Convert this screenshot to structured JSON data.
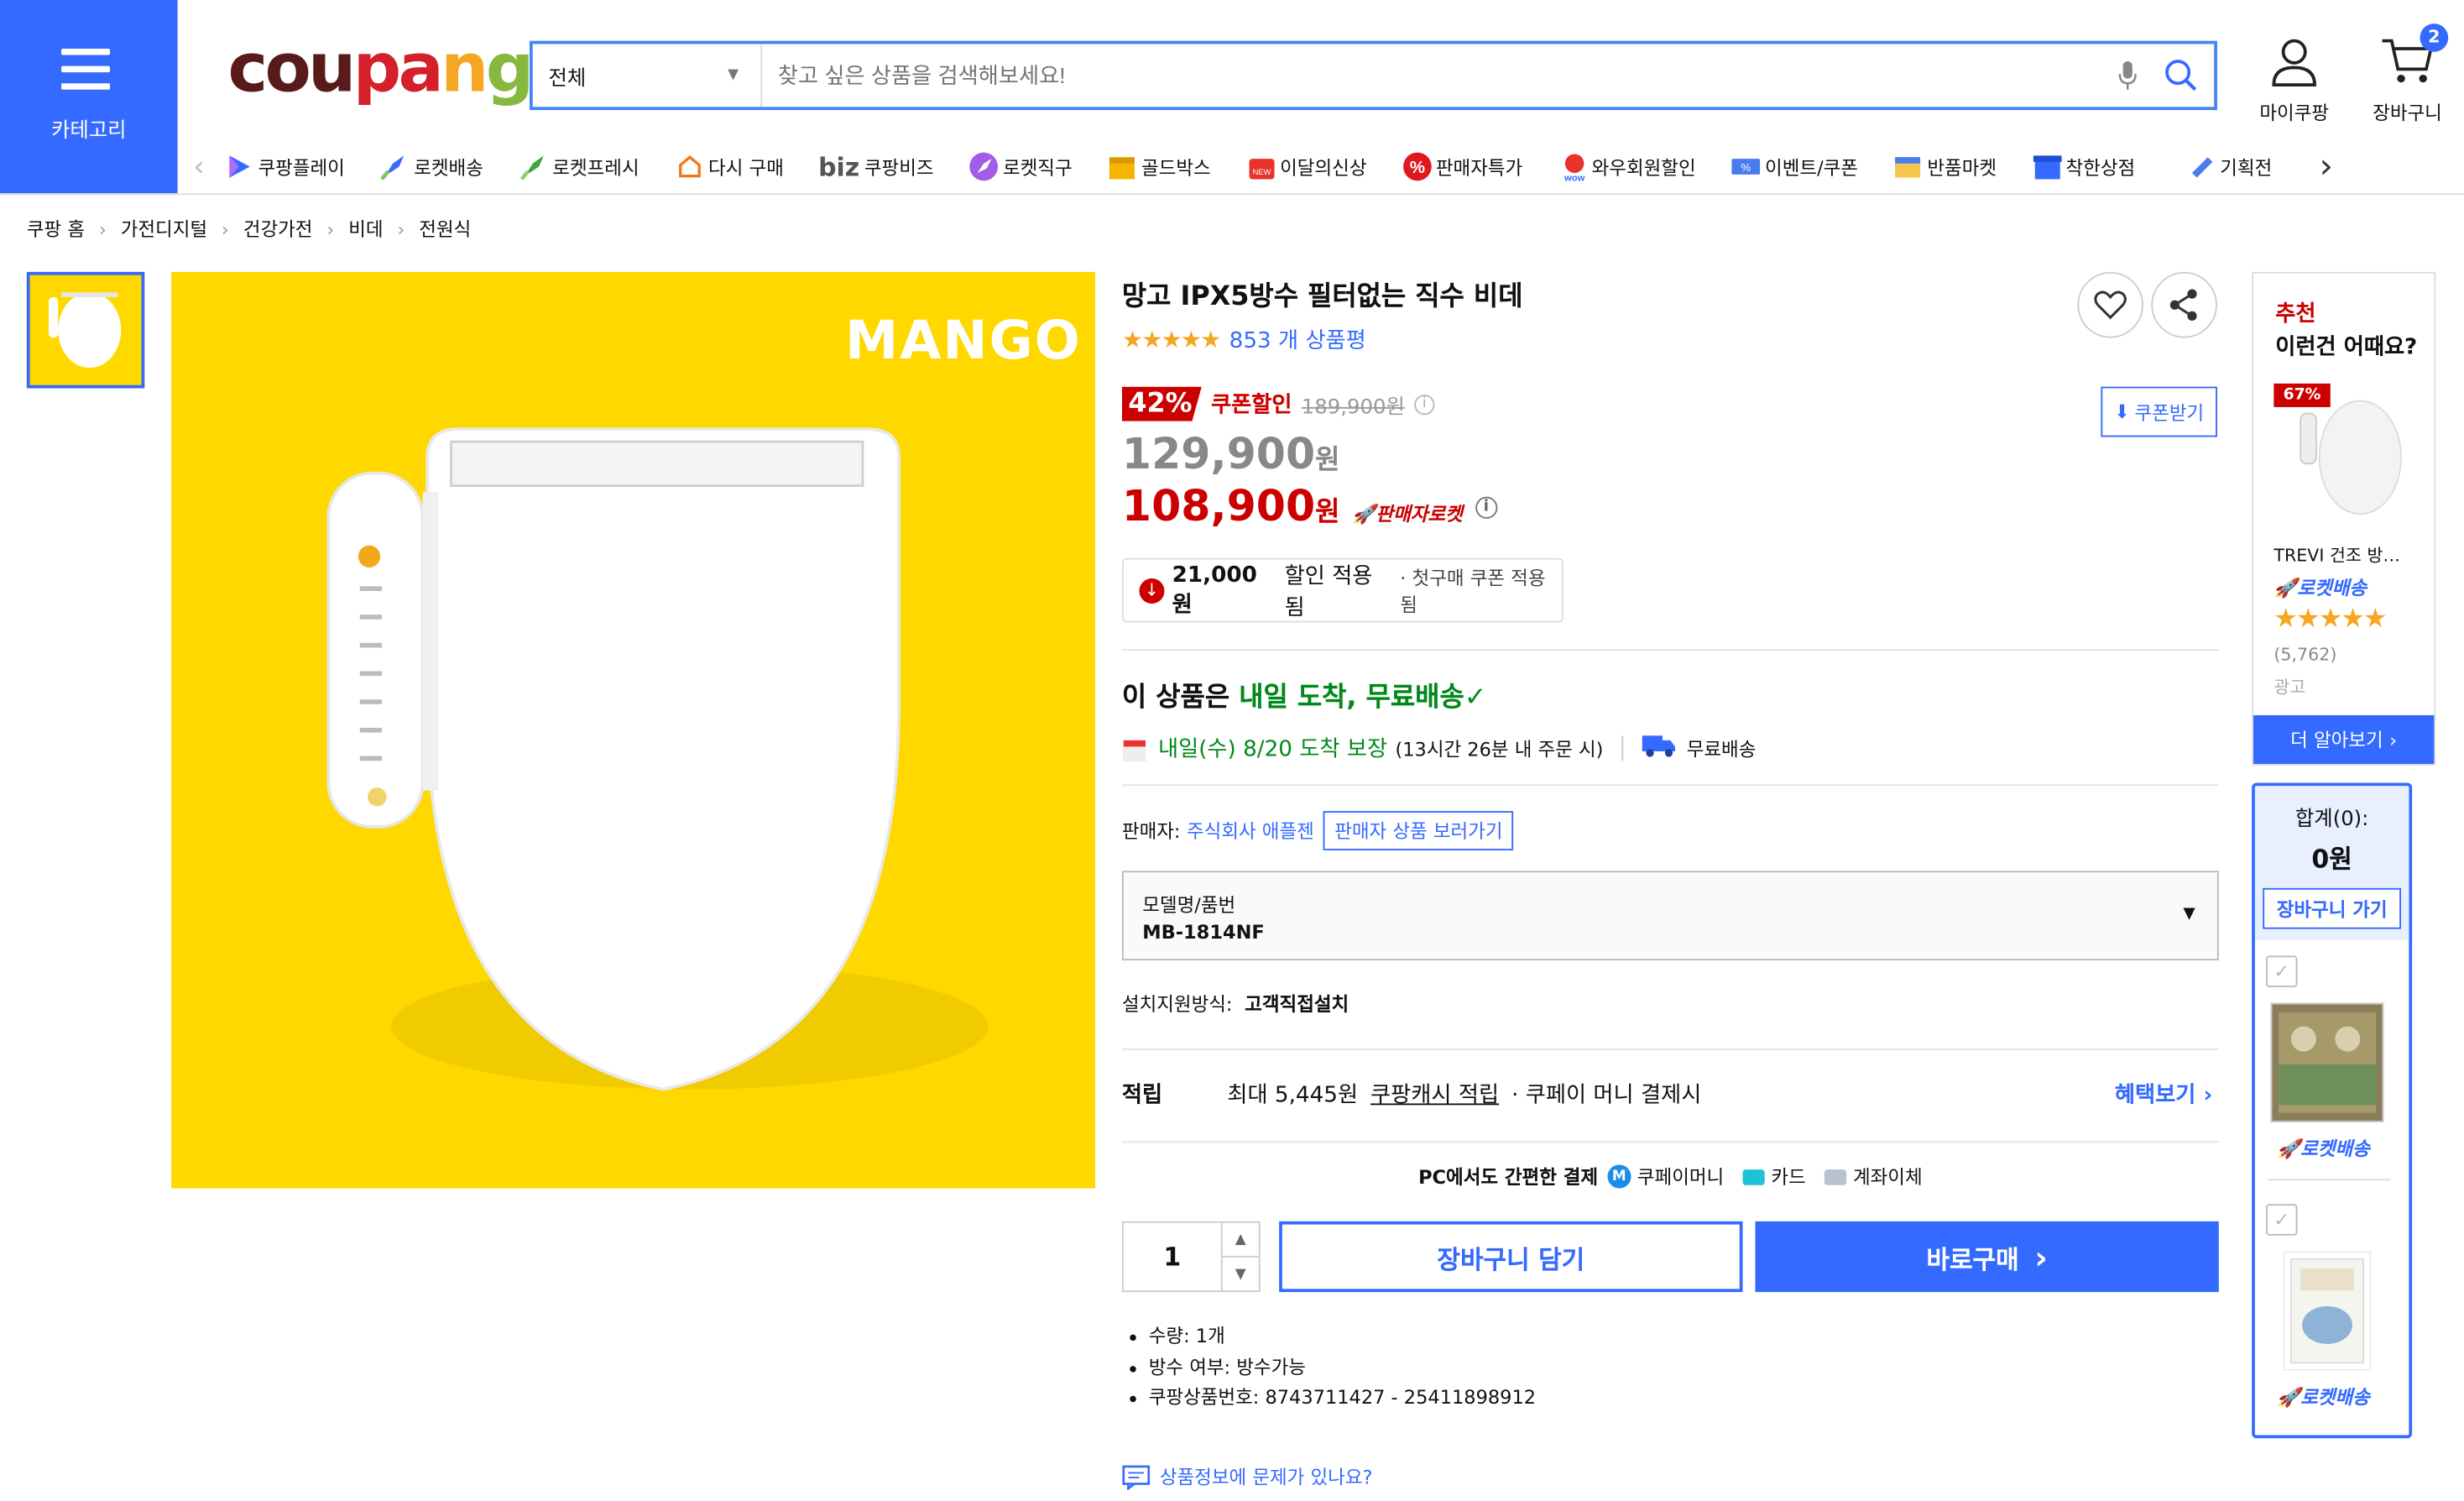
{
  "header": {
    "category_label": "카테고리",
    "logo": "coupang",
    "search": {
      "category": "전체",
      "placeholder": "찾고 싶은 상품을 검색해보세요!"
    },
    "mycoupang_label": "마이쿠팡",
    "cart_label": "장바구니",
    "cart_count": "2"
  },
  "nav_items": [
    {
      "label": "쿠팡플레이",
      "icon": "play-icon"
    },
    {
      "label": "로켓배송",
      "icon": "rocket-icon"
    },
    {
      "label": "로켓프레시",
      "icon": "rocket-fresh-icon"
    },
    {
      "label": "다시 구매",
      "icon": "rebuy-icon"
    },
    {
      "label": "쿠팡비즈",
      "prefix": "biz",
      "icon": "biz-icon"
    },
    {
      "label": "로켓직구",
      "icon": "rocket-direct-icon"
    },
    {
      "label": "골드박스",
      "icon": "goldbox-icon"
    },
    {
      "label": "이달의신상",
      "icon": "new-icon"
    },
    {
      "label": "판매자특가",
      "icon": "percent-icon"
    },
    {
      "label": "와우회원할인",
      "icon": "wow-icon"
    },
    {
      "label": "이벤트/쿠폰",
      "icon": "coupon-icon"
    },
    {
      "label": "반품마켓",
      "icon": "return-market-icon"
    },
    {
      "label": "착한상점",
      "icon": "good-store-icon"
    },
    {
      "label": "기획전",
      "icon": "exhibition-icon"
    }
  ],
  "breadcrumb": [
    "쿠팡 홈",
    "가전디지털",
    "건강가전",
    "비데",
    "전원식"
  ],
  "product": {
    "brand_mark": "MANGO",
    "title": "망고 IPX5방수 필터없는 직수 비데",
    "review_count": "853 개 상품평",
    "discount_percent": "42%",
    "coupon_discount_label": "쿠폰할인",
    "original_price": "189,900원",
    "coupon_button": "쿠폰받기",
    "sale_price": "129,900",
    "final_price": "108,900",
    "won": "원",
    "seller_rocket": "판매자로켓",
    "applied_amount": "21,000원",
    "applied_text": "할인 적용됨",
    "applied_note": "· 첫구매 쿠폰 적용됨",
    "delivery_prefix": "이 상품은 ",
    "delivery_highlight": "내일 도착, 무료배송",
    "arrival_date": "내일(수) 8/20 도착 보장",
    "arrival_note": "(13시간 26분 내 주문 시)",
    "free_shipping": "무료배송",
    "seller_label": "판매자:",
    "seller_name": "주식회사 애플젠",
    "seller_products": "판매자 상품 보러가기",
    "option_label": "모델명/품번",
    "option_value": "MB-1814NF",
    "install_label": "설치지원방식:",
    "install_value": "고객직접설치",
    "reward_label": "적립",
    "reward_text": "최대 5,445원",
    "reward_link": "쿠팡캐시 적립",
    "reward_suffix": "· 쿠페이 머니 결제시",
    "benefit_link": "혜택보기",
    "pay_title": "PC에서도 간편한 결제",
    "pay_money": "쿠페이머니",
    "pay_card": "카드",
    "pay_account": "계좌이체",
    "quantity": "1",
    "cart_button": "장바구니 담기",
    "buy_button": "바로구매",
    "specs": [
      "수량: 1개",
      "방수 여부: 방수가능",
      "쿠팡상품번호: 8743711427 - 25411898912"
    ],
    "report_link": "상품정보에 문제가 있나요?"
  },
  "recommend": {
    "title_red": "추천",
    "title": "이런건 어때요?",
    "badge": "67%",
    "item_name": "TREVI 건조 방…",
    "rocket": "로켓배송",
    "reviews": "(5,762)",
    "ad": "광고",
    "more": "더 알아보기"
  },
  "cart_summary": {
    "total_label": "합계(0):",
    "total_value": "0원",
    "go_cart": "장바구니 가기",
    "rocket1": "로켓배송",
    "rocket2": "로켓배송"
  },
  "colors": {
    "accent": "#346aff",
    "red": "#cc0000",
    "green": "#00891a",
    "yellow": "#ffd800"
  }
}
